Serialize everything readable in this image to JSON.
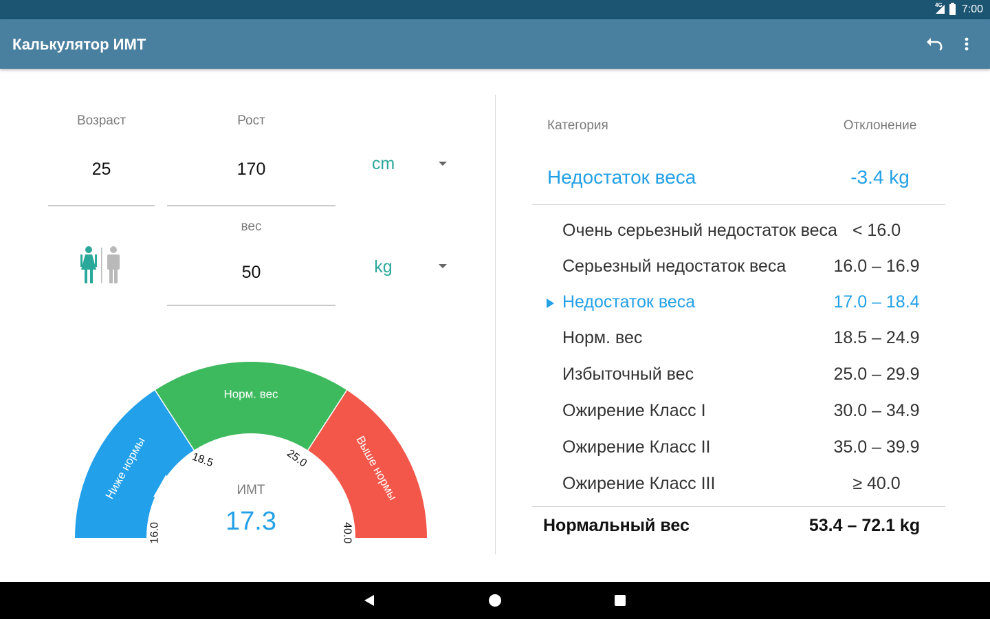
{
  "status_bar": {
    "network": "4G",
    "time": "7:00"
  },
  "app_bar": {
    "title": "Калькулятор ИМТ"
  },
  "inputs": {
    "age_label": "Возраст",
    "age_value": "25",
    "height_label": "Рост",
    "height_value": "170",
    "height_unit": "cm",
    "weight_label": "вес",
    "weight_value": "50",
    "weight_unit": "kg"
  },
  "gauge": {
    "zones": [
      "Ниже нормы",
      "Норм. вес",
      "Выше нормы"
    ],
    "ticks": [
      "16.0",
      "18.5",
      "25.0",
      "40.0"
    ],
    "bmi_label": "ИМТ",
    "bmi_value": "17.3",
    "bmi_numeric": 17.3,
    "colors": {
      "below": "#22a0ea",
      "normal": "#3dba5e",
      "above": "#f2574a"
    }
  },
  "result": {
    "category_header": "Категория",
    "deviation_header": "Отклонение",
    "current_category": "Недостаток веса",
    "current_deviation": "-3.4 kg",
    "rows": [
      {
        "name": "Очень серьезный недостаток веса",
        "range": "< 16.0"
      },
      {
        "name": "Серьезный недостаток веса",
        "range": "16.0 – 16.9"
      },
      {
        "name": "Недостаток веса",
        "range": "17.0 – 18.4"
      },
      {
        "name": "Норм. вес",
        "range": "18.5 – 24.9"
      },
      {
        "name": "Избыточный вес",
        "range": "25.0 – 29.9"
      },
      {
        "name": "Ожирение Класс I",
        "range": "30.0 – 34.9"
      },
      {
        "name": "Ожирение Класс II",
        "range": "35.0 – 39.9"
      },
      {
        "name": "Ожирение Класс III",
        "range": "≥ 40.0"
      }
    ],
    "normal_weight_label": "Нормальный вес",
    "normal_weight_value": "53.4 – 72.1 kg"
  },
  "colors": {
    "accent": "#23a0e6",
    "teal": "#2aa89a",
    "app_bar": "#4a809f",
    "status_bar": "#1b5572"
  }
}
